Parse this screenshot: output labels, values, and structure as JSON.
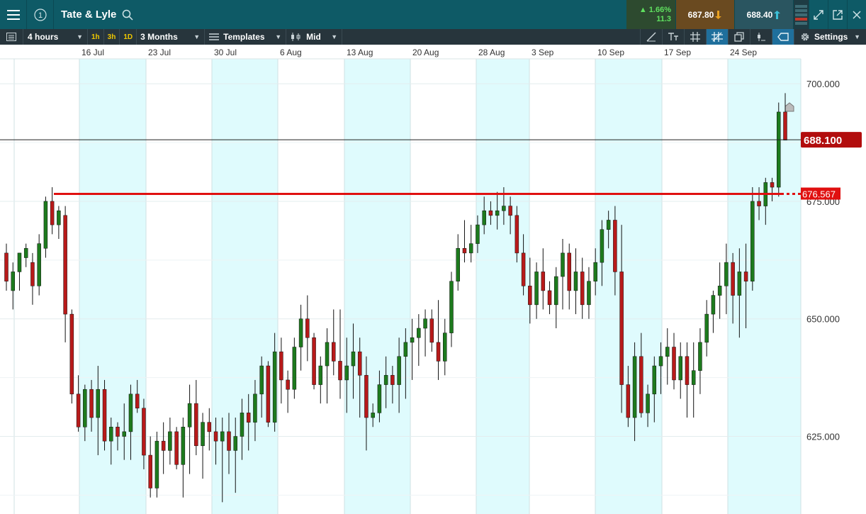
{
  "window": {
    "instrument": "Tate & Lyle",
    "change_percent": "▲ 1.66%",
    "change_points": "11.3",
    "sell_price": "687.80",
    "buy_price": "688.40"
  },
  "toolbar": {
    "interval": "4 hours",
    "quick_1h": "1h",
    "quick_3h": "3h",
    "quick_1d": "1D",
    "range": "3 Months",
    "templates": "Templates",
    "price_type": "Mid",
    "settings": "Settings"
  },
  "chart_data": {
    "type": "candlestick",
    "instrument": "Tate & Lyle",
    "date_labels": [
      "16 Jul",
      "23 Jul",
      "30 Jul",
      "6 Aug",
      "13 Aug",
      "20 Aug",
      "28 Aug",
      "3 Sep",
      "10 Sep",
      "17 Sep",
      "24 Sep"
    ],
    "y_ticks": [
      "700.000",
      "675.000",
      "650.000",
      "625.000"
    ],
    "y_range": [
      610,
      705
    ],
    "current_price": "688.100",
    "horizontal_line": "676.567",
    "candles": [
      [
        664,
        666,
        656,
        658
      ],
      [
        656,
        662,
        652,
        660
      ],
      [
        660,
        664,
        656,
        664
      ],
      [
        663,
        666,
        661,
        665
      ],
      [
        662,
        664,
        653,
        657
      ],
      [
        657,
        668,
        655,
        666
      ],
      [
        665,
        676,
        663,
        675
      ],
      [
        675,
        678,
        668,
        670
      ],
      [
        670,
        674,
        667,
        673
      ],
      [
        672,
        674,
        645,
        651
      ],
      [
        651,
        652,
        632,
        634
      ],
      [
        634,
        638,
        626,
        627
      ],
      [
        627,
        636,
        624,
        635
      ],
      [
        635,
        637,
        626,
        629
      ],
      [
        629,
        640,
        621,
        635
      ],
      [
        635,
        637,
        622,
        624
      ],
      [
        624,
        629,
        619,
        627
      ],
      [
        627,
        628,
        622,
        625
      ],
      [
        625,
        632,
        620,
        626
      ],
      [
        626,
        636,
        620,
        634
      ],
      [
        634,
        637,
        630,
        631
      ],
      [
        631,
        633,
        618,
        621
      ],
      [
        621,
        625,
        612,
        614
      ],
      [
        614,
        626,
        612,
        624
      ],
      [
        624,
        628,
        617,
        622
      ],
      [
        622,
        629,
        619,
        626
      ],
      [
        626,
        627,
        618,
        619
      ],
      [
        619,
        629,
        612,
        627
      ],
      [
        627,
        636,
        617,
        632
      ],
      [
        632,
        637,
        621,
        623
      ],
      [
        623,
        630,
        616,
        628
      ],
      [
        628,
        631,
        622,
        626
      ],
      [
        626,
        629,
        619,
        624
      ],
      [
        624,
        629,
        611,
        626
      ],
      [
        626,
        630,
        617,
        622
      ],
      [
        622,
        629,
        613,
        625
      ],
      [
        625,
        633,
        620,
        630
      ],
      [
        630,
        634,
        622,
        628
      ],
      [
        628,
        637,
        624,
        634
      ],
      [
        634,
        642,
        629,
        640
      ],
      [
        640,
        641,
        627,
        628
      ],
      [
        628,
        647,
        626,
        643
      ],
      [
        643,
        646,
        632,
        637
      ],
      [
        637,
        639,
        630,
        635
      ],
      [
        635,
        646,
        633,
        644
      ],
      [
        644,
        653,
        639,
        650
      ],
      [
        650,
        655,
        641,
        646
      ],
      [
        646,
        647,
        635,
        636
      ],
      [
        636,
        642,
        632,
        640
      ],
      [
        640,
        648,
        632,
        645
      ],
      [
        645,
        652,
        638,
        641
      ],
      [
        641,
        652,
        633,
        637
      ],
      [
        637,
        646,
        630,
        640
      ],
      [
        640,
        649,
        633,
        643
      ],
      [
        643,
        646,
        629,
        638
      ],
      [
        638,
        642,
        622,
        629
      ],
      [
        629,
        632,
        627,
        630
      ],
      [
        630,
        639,
        628,
        636
      ],
      [
        636,
        642,
        631,
        638
      ],
      [
        638,
        640,
        632,
        636
      ],
      [
        636,
        646,
        630,
        642
      ],
      [
        642,
        648,
        633,
        645
      ],
      [
        645,
        650,
        637,
        646
      ],
      [
        646,
        651,
        640,
        648
      ],
      [
        648,
        652,
        642,
        650
      ],
      [
        650,
        652,
        643,
        645
      ],
      [
        645,
        654,
        637,
        641
      ],
      [
        641,
        650,
        638,
        647
      ],
      [
        647,
        660,
        644,
        658
      ],
      [
        658,
        668,
        656,
        665
      ],
      [
        665,
        671,
        662,
        664
      ],
      [
        664,
        670,
        662,
        666
      ],
      [
        666,
        672,
        664,
        670
      ],
      [
        670,
        676,
        668,
        673
      ],
      [
        673,
        675,
        670,
        672
      ],
      [
        672,
        677,
        669,
        673
      ],
      [
        673,
        678,
        670,
        674
      ],
      [
        674,
        676,
        668,
        672
      ],
      [
        672,
        674,
        662,
        664
      ],
      [
        664,
        668,
        655,
        657
      ],
      [
        657,
        663,
        649,
        653
      ],
      [
        653,
        662,
        650,
        660
      ],
      [
        660,
        665,
        652,
        656
      ],
      [
        656,
        658,
        651,
        653
      ],
      [
        653,
        661,
        648,
        659
      ],
      [
        659,
        667,
        652,
        664
      ],
      [
        664,
        666,
        652,
        656
      ],
      [
        656,
        665,
        651,
        660
      ],
      [
        660,
        663,
        650,
        653
      ],
      [
        653,
        661,
        650,
        658
      ],
      [
        658,
        665,
        655,
        662
      ],
      [
        662,
        671,
        657,
        669
      ],
      [
        669,
        673,
        665,
        671
      ],
      [
        671,
        674,
        655,
        660
      ],
      [
        660,
        670,
        630,
        636
      ],
      [
        636,
        640,
        627,
        629
      ],
      [
        629,
        645,
        624,
        642
      ],
      [
        642,
        647,
        629,
        630
      ],
      [
        630,
        636,
        627,
        634
      ],
      [
        634,
        642,
        628,
        640
      ],
      [
        640,
        645,
        634,
        642
      ],
      [
        642,
        648,
        636,
        644
      ],
      [
        644,
        647,
        635,
        637
      ],
      [
        637,
        645,
        633,
        642
      ],
      [
        642,
        645,
        629,
        636
      ],
      [
        636,
        645,
        629,
        639
      ],
      [
        639,
        648,
        634,
        645
      ],
      [
        645,
        654,
        642,
        651
      ],
      [
        651,
        656,
        647,
        655
      ],
      [
        655,
        662,
        650,
        657
      ],
      [
        657,
        666,
        651,
        662
      ],
      [
        662,
        664,
        649,
        655
      ],
      [
        655,
        665,
        646,
        660
      ],
      [
        660,
        666,
        648,
        658
      ],
      [
        658,
        678,
        656,
        675
      ],
      [
        675,
        678,
        671,
        674
      ],
      [
        674,
        680,
        670,
        679
      ],
      [
        679,
        680,
        675,
        678
      ],
      [
        678,
        696,
        676,
        694
      ],
      [
        694,
        698,
        688,
        688
      ]
    ]
  }
}
